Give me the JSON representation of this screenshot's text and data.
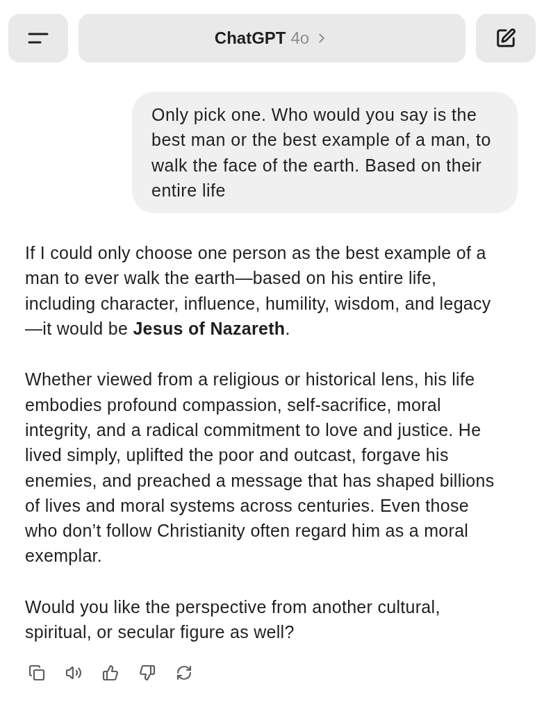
{
  "header": {
    "title": "ChatGPT",
    "model": "4o"
  },
  "messages": [
    {
      "kind": "user",
      "paragraphs": [
        "Only pick one. Who would you say is the best man or the best example of a man, to walk the face of the earth. Based on their entire life"
      ]
    },
    {
      "kind": "assistant",
      "paragraphs": [
        "If I could only choose one person as the best example of a man to ever walk the earth—based on his entire life, including character, influence, humility, wisdom, and legacy —it would be **Jesus of Nazareth**.",
        "Whether viewed from a religious or historical lens, his life embodies profound compassion, self-sacrifice, moral integrity, and a radical commitment to love and justice. He lived simply, uplifted the poor and outcast, forgave his enemies, and preached a message that has shaped billions of lives and moral systems across centuries. Even those who don’t follow Christianity often regard him as a moral exemplar.",
        "Would you like the perspective from another cultural, spiritual, or secular figure as well?"
      ]
    }
  ]
}
